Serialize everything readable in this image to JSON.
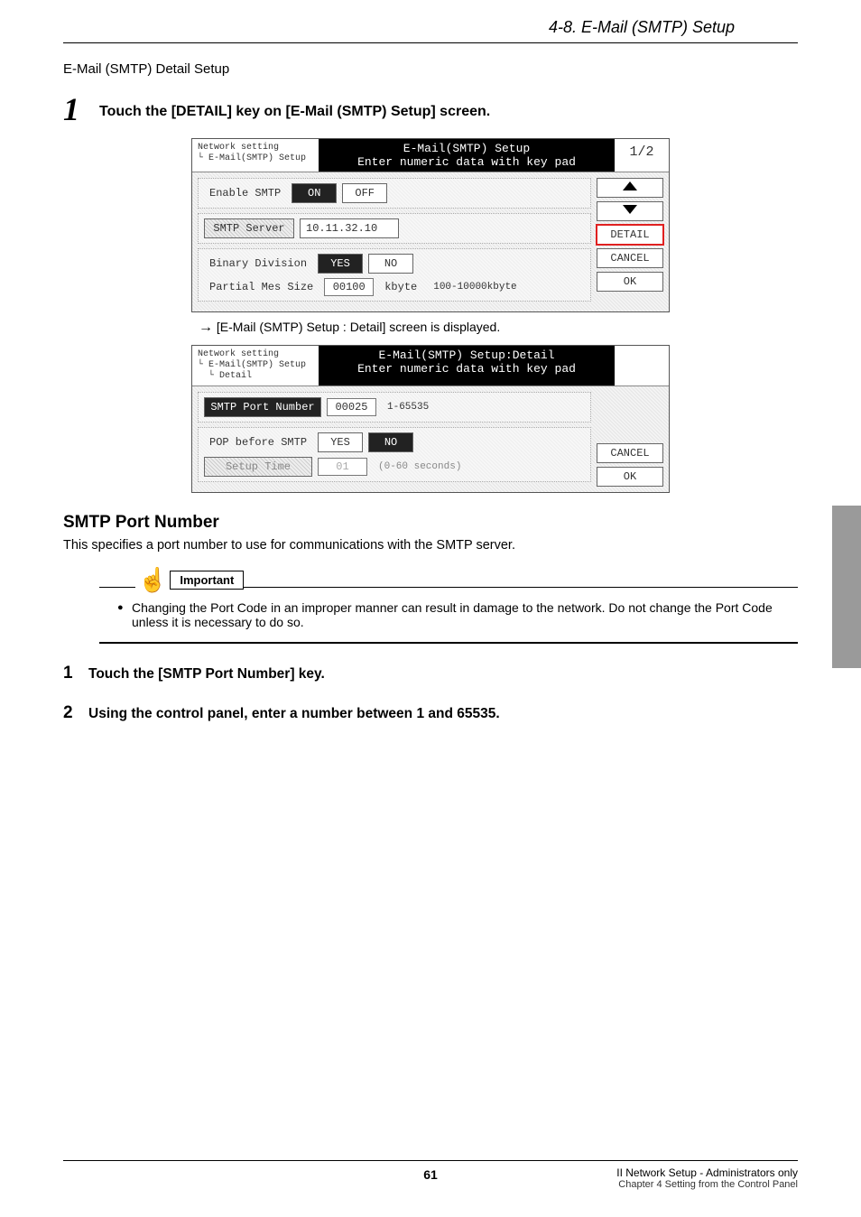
{
  "header": {
    "breadcrumb": "4-8. E-Mail (SMTP) Setup"
  },
  "subsection": {
    "title": "E-Mail (SMTP) Detail Setup"
  },
  "step1": {
    "number": "1",
    "text": "Touch the [DETAIL] key on [E-Mail (SMTP) Setup] screen."
  },
  "panel1": {
    "crumb1": "Network setting",
    "crumb2": "E-Mail(SMTP) Setup",
    "title_line1": "E-Mail(SMTP) Setup",
    "title_line2": "Enter numeric data with key pad",
    "page": "1/2",
    "rows": {
      "enable_label": "Enable SMTP",
      "on": "ON",
      "off": "OFF",
      "server_label": "SMTP Server",
      "server_value": "10.11.32.10",
      "binary_label": "Binary Division",
      "yes": "YES",
      "no": "NO",
      "partial_label": "Partial Mes Size",
      "partial_value": "00100",
      "partial_unit": "kbyte",
      "partial_range": "100-10000kbyte"
    },
    "side": {
      "detail": "DETAIL",
      "cancel": "CANCEL",
      "ok": "OK"
    }
  },
  "resultArrow": {
    "text": "[E-Mail (SMTP) Setup : Detail] screen is displayed."
  },
  "panel2": {
    "crumb1": "Network setting",
    "crumb2": "E-Mail(SMTP) Setup",
    "crumb3": "Detail",
    "title_line1": "E-Mail(SMTP) Setup:Detail",
    "title_line2": "Enter numeric data with key pad",
    "rows": {
      "port_label": "SMTP Port Number",
      "port_value": "00025",
      "port_range": "1-65535",
      "pop_label": "POP before SMTP",
      "yes": "YES",
      "no": "NO",
      "setup_label": "Setup Time",
      "setup_value": "01",
      "setup_range": "(0-60 seconds)"
    },
    "side": {
      "cancel": "CANCEL",
      "ok": "OK"
    }
  },
  "smtpPort": {
    "heading": "SMTP Port Number",
    "desc": "This specifies a port number to use for communications with the SMTP server."
  },
  "important": {
    "label": "Important",
    "note": "Changing the Port Code in an improper manner can result in damage to the network. Do not change the Port Code unless it is necessary to do so."
  },
  "substep1": {
    "num": "1",
    "text": "Touch the [SMTP Port Number] key."
  },
  "substep2": {
    "num": "2",
    "text": "Using the control panel, enter a number between 1 and 65535."
  },
  "footer": {
    "page_num": "61",
    "right1": "II Network Setup - Administrators only",
    "right2": "Chapter 4 Setting from the Control Panel"
  }
}
